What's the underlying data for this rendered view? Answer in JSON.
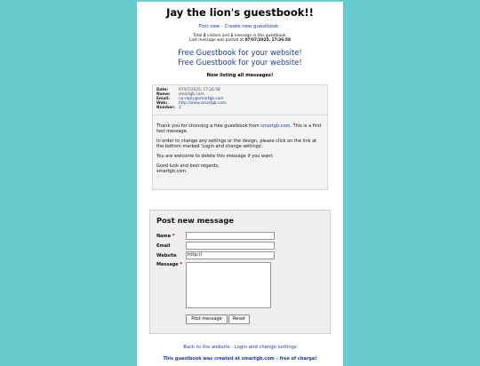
{
  "page": {
    "title": "Jay the lion's guestbook!!",
    "top_links": {
      "post_new": "Post new",
      "create_new": "Create new guestbook"
    },
    "stats": {
      "line1_prefix": "Total ",
      "visitors": "2",
      "line1_mid": " visitors and ",
      "messages": "1",
      "line1_suffix": " message in this guestbook.",
      "line2_prefix": "Last message was posted at ",
      "last_posted": "07/07/2025, 17:26:58"
    },
    "free_links": [
      "Free Guestbook for your website!",
      "Free Guestbook for your website!"
    ],
    "listing": "Now listing all messages!"
  },
  "entry": {
    "meta": [
      {
        "key": "Date:",
        "value": "07/07/2025, 17:26:58",
        "link": false
      },
      {
        "key": "Name:",
        "value": "smartgb.com",
        "link": false
      },
      {
        "key": "Email:",
        "value": "no-reply@smartgb.com",
        "link": true
      },
      {
        "key": "Web:",
        "value": "http://www.smartgb.com",
        "link": true
      },
      {
        "key": "Number:",
        "value": "1",
        "link": false
      }
    ],
    "p1_prefix": "Thank you for choosing a free guestbook from ",
    "p1_link": "smartgb.com",
    "p1_suffix": ". This is a first test message.",
    "p2": "In order to change any settings or the design, please click on the link at the bottom marked 'Login and change settings'.",
    "p3": "You are welcome to delete this message if you want.",
    "p4_line1": "Good luck and best regards,",
    "p4_line2": "smartgb.com."
  },
  "form": {
    "heading": "Post new message",
    "name_label": "Name",
    "email_label": "Email",
    "website_label": "Website",
    "message_label": "Message",
    "required_mark": "*",
    "website_value": "http://",
    "post_button": "Post message",
    "reset_button": "Reset"
  },
  "bottom": {
    "back_link": "Back to the website",
    "login_link": "Login and change settings",
    "footer": "This guestbook was created at smartgb.com - free of charge!"
  }
}
